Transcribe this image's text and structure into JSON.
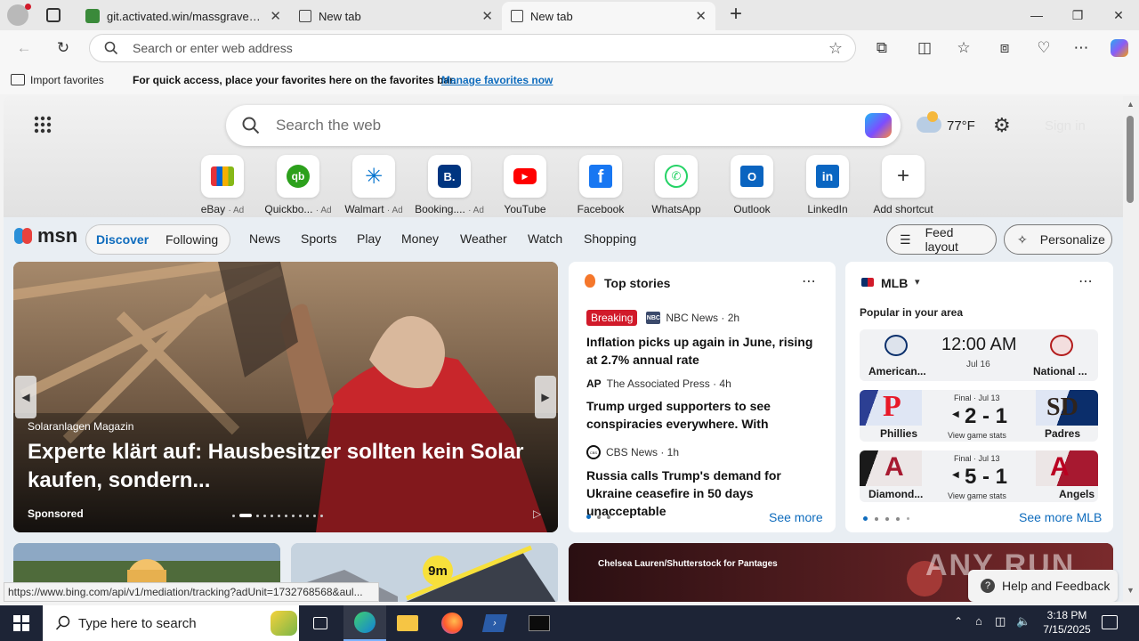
{
  "browser": {
    "tabs": [
      {
        "title": "git.activated.win/massgrave/Micr",
        "active": false
      },
      {
        "title": "New tab",
        "active": false
      },
      {
        "title": "New tab",
        "active": true
      }
    ],
    "new_tab_symbol": "+",
    "address_placeholder": "Search or enter web address",
    "favbar": {
      "import_label": "Import favorites",
      "hint_text": "For quick access, place your favorites here on the favorites bar.",
      "manage_link": "Manage favorites now"
    }
  },
  "newtab": {
    "search_placeholder": "Search the web",
    "weather_temp": "77°F",
    "sign_in": "Sign in",
    "shortcuts": [
      {
        "label": "eBay",
        "ad": "· Ad",
        "icon": "ebay-icon"
      },
      {
        "label": "Quickbo...",
        "ad": "· Ad",
        "icon": "quickbooks-icon"
      },
      {
        "label": "Walmart",
        "ad": "· Ad",
        "icon": "walmart-icon"
      },
      {
        "label": "Booking....",
        "ad": "· Ad",
        "icon": "booking-icon"
      },
      {
        "label": "YouTube",
        "ad": "",
        "icon": "youtube-icon"
      },
      {
        "label": "Facebook",
        "ad": "",
        "icon": "facebook-icon"
      },
      {
        "label": "WhatsApp",
        "ad": "",
        "icon": "whatsapp-icon"
      },
      {
        "label": "Outlook",
        "ad": "",
        "icon": "outlook-icon"
      },
      {
        "label": "LinkedIn",
        "ad": "",
        "icon": "linkedin-icon"
      },
      {
        "label": "Add shortcut",
        "ad": "",
        "icon": "plus-icon"
      }
    ],
    "shortcut_letters": {
      "quickbooks": "qb",
      "booking": "B.",
      "facebook": "f",
      "linkedin": "in",
      "outlook": "O",
      "plus": "+"
    },
    "msn_logo": "msn",
    "feed_tabs": [
      "Discover",
      "Following"
    ],
    "nav_links": [
      "News",
      "Sports",
      "Play",
      "Money",
      "Weather",
      "Watch",
      "Shopping"
    ],
    "feed_layout": "Feed layout",
    "personalize": "Personalize"
  },
  "hero": {
    "source": "Solaranlagen Magazin",
    "headline": "Experte klärt auf: Hausbesitzer sollten kein Solar kaufen, sondern...",
    "sponsored": "Sponsored"
  },
  "top_stories": {
    "title": "Top stories",
    "items": [
      {
        "badge": "Breaking",
        "source": "NBC News · 2h",
        "headline": "Inflation picks up again in June, rising at 2.7% annual rate",
        "logo": "NBC"
      },
      {
        "badge": "",
        "source": "The Associated Press · 4h",
        "headline": "Trump urged supporters to see conspiracies everywhere. With Epstein,...",
        "logo": "AP"
      },
      {
        "badge": "",
        "source": "CBS News · 1h",
        "headline": "Russia calls Trump's demand for Ukraine ceasefire in 50 days unacceptable",
        "logo": "CBS"
      }
    ],
    "see_more": "See more"
  },
  "mlb": {
    "title": "MLB",
    "subtitle": "Popular in your area",
    "games": [
      {
        "team1": "American...",
        "team2": "National ...",
        "time": "12:00 AM",
        "date": "Jul 16",
        "status": "",
        "score": "",
        "stats": ""
      },
      {
        "team1": "Phillies",
        "team2": "Padres",
        "status": "Final · Jul 13",
        "score": "2 - 1",
        "stats": "View game stats",
        "time": "",
        "date": ""
      },
      {
        "team1": "Diamond...",
        "team2": "Angels",
        "status": "Final · Jul 13",
        "score": "5 - 1",
        "stats": "View game stats",
        "time": "",
        "date": ""
      }
    ],
    "see_more": "See more MLB",
    "team_letters": {
      "phillies": "P",
      "padres": "SD",
      "diamondbacks": "A",
      "angels": "A"
    }
  },
  "lower_cards": {
    "badge": "9m",
    "photo_credit": "Chelsea Lauren/Shutterstock for Pantages"
  },
  "help_feedback": "Help and Feedback",
  "watermark": "ANY RUN",
  "status_url": "https://www.bing.com/api/v1/mediation/tracking?adUnit=1732768568&aul...",
  "taskbar": {
    "search_placeholder": "Type here to search",
    "time": "3:18 PM",
    "date": "7/15/2025"
  },
  "colors": {
    "accent": "#0f6cbd",
    "breaking": "#d11a2a",
    "taskbar": "#1d2436",
    "phillies": "#e81828",
    "padres": "#2f241d",
    "diamondbacks": "#a71930",
    "angels": "#ba0021"
  }
}
